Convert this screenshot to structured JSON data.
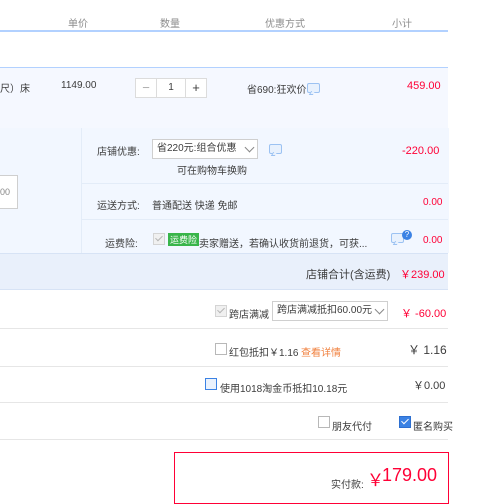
{
  "header": {
    "unit_price": "单价",
    "quantity": "数量",
    "discount_method": "优惠方式",
    "subtotal": "小计"
  },
  "item": {
    "spec_fragment": "尺）床",
    "unit_price": "1149.00",
    "quantity": "1",
    "discount": "省690:狂欢价",
    "subtotal": "459.00"
  },
  "shop": {
    "left_input_text": "00",
    "coupon_label": "店铺优惠:",
    "coupon_selected": "省220元:组合优惠",
    "coupon_note": "可在购物车换购",
    "coupon_amount": "-220.00",
    "shipping_label": "运送方式:",
    "shipping_value": "普通配送 快递 免邮",
    "shipping_amount": "0.00",
    "insurance_label": "运费险:",
    "insurance_tag": "运费险",
    "insurance_text": "卖家赠送，若确认收货前退货，可获...",
    "insurance_amount": "0.00",
    "total_label": "店铺合计(含运费)",
    "total_amount": "￥239.00"
  },
  "cross_store": {
    "label": "跨店满减",
    "selected": "跨店满减抵扣60.00元",
    "amount": "￥ -60.00"
  },
  "red_packet": {
    "label": "红包抵扣￥1.16",
    "link": "查看详情",
    "amount": "￥ 1.16"
  },
  "tmall_points": {
    "label": "使用1018淘金币抵扣10.18元",
    "amount": "￥0.00"
  },
  "options": {
    "friend_pay": "朋友代付",
    "anonymous": "匿名购买"
  },
  "payment": {
    "label": "实付款:",
    "currency": "￥",
    "amount": "179.00"
  },
  "colors": {
    "accent_red": "#ff0036",
    "accent_blue": "#3b82e4",
    "row_bg": "#f5f8ff"
  }
}
